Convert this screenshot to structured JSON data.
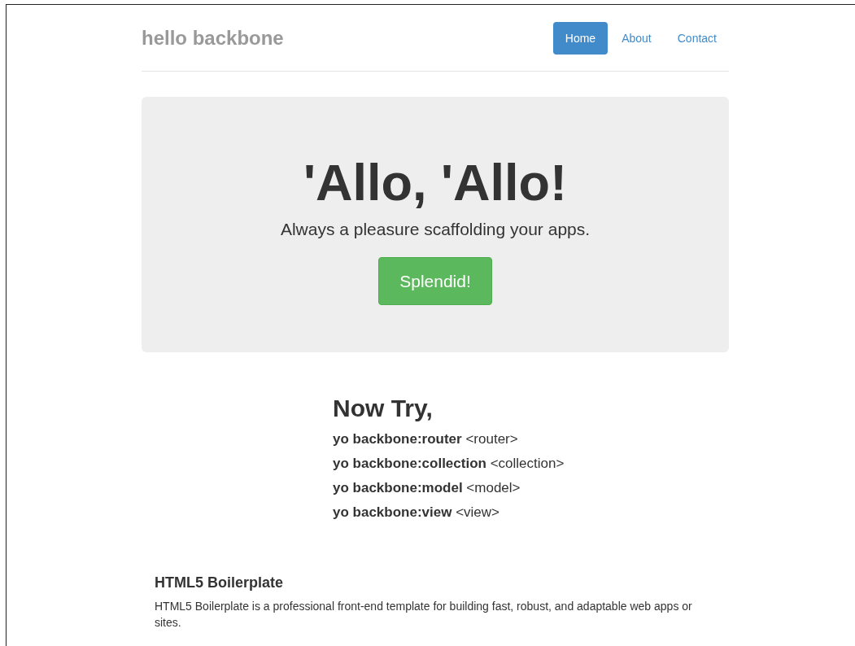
{
  "brand": "hello backbone",
  "nav": [
    {
      "label": "Home",
      "selected": true
    },
    {
      "label": "About",
      "selected": false
    },
    {
      "label": "Contact",
      "selected": false
    }
  ],
  "jumbotron": {
    "heading": "'Allo, 'Allo!",
    "lead": "Always a pleasure scaffolding your apps.",
    "button": "Splendid!"
  },
  "now_try": {
    "heading": "Now Try,",
    "commands": [
      "**yo backbone:router** <router>",
      "**yo backbone:collection** <collection>",
      "**yo backbone:model** <model>",
      "**yo backbone:view** <view>"
    ]
  },
  "features": [
    {
      "title": "HTML5 Boilerplate",
      "text": "HTML5 Boilerplate is a professional front-end template for building fast, robust, and adaptable web apps or sites."
    }
  ]
}
